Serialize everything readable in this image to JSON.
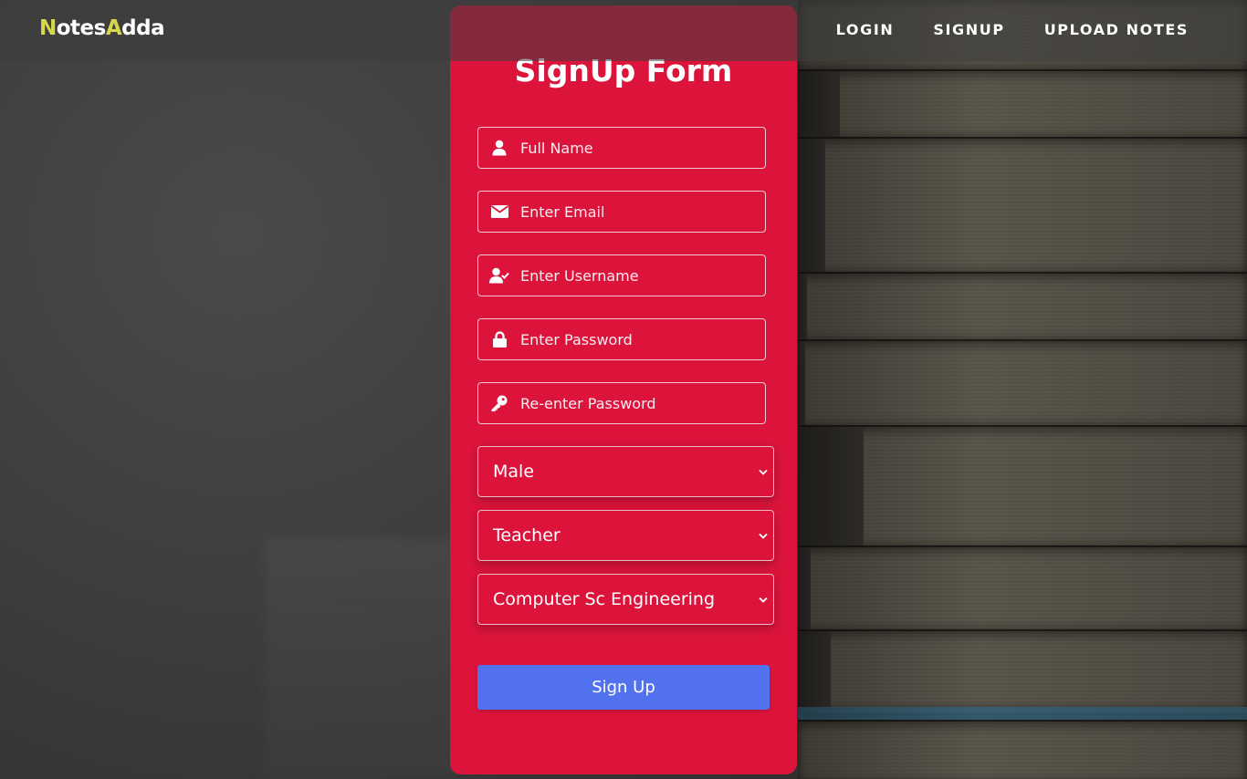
{
  "navbar": {
    "logo": {
      "part1_accent": "N",
      "part1_rest": "otes",
      "part2_accent": "A",
      "part2_rest": "dda"
    },
    "links": [
      {
        "label": "LOGIN"
      },
      {
        "label": "SIGNUP"
      },
      {
        "label": "UPLOAD NOTES"
      }
    ]
  },
  "form": {
    "title": "SignUp Form",
    "fields": [
      {
        "placeholder": "Full Name",
        "icon": "user-icon"
      },
      {
        "placeholder": "Enter Email",
        "icon": "envelope-icon"
      },
      {
        "placeholder": "Enter Username",
        "icon": "user-check-icon"
      },
      {
        "placeholder": "Enter Password",
        "icon": "lock-icon"
      },
      {
        "placeholder": "Re-enter Password",
        "icon": "key-icon"
      }
    ],
    "selects": [
      {
        "value": "Male"
      },
      {
        "value": "Teacher"
      },
      {
        "value": "Computer Sc Engineering"
      }
    ],
    "submit_label": "Sign Up"
  },
  "colors": {
    "card": "#dc143c",
    "button": "#5271ee",
    "logo_accent": "#d4d84a"
  }
}
